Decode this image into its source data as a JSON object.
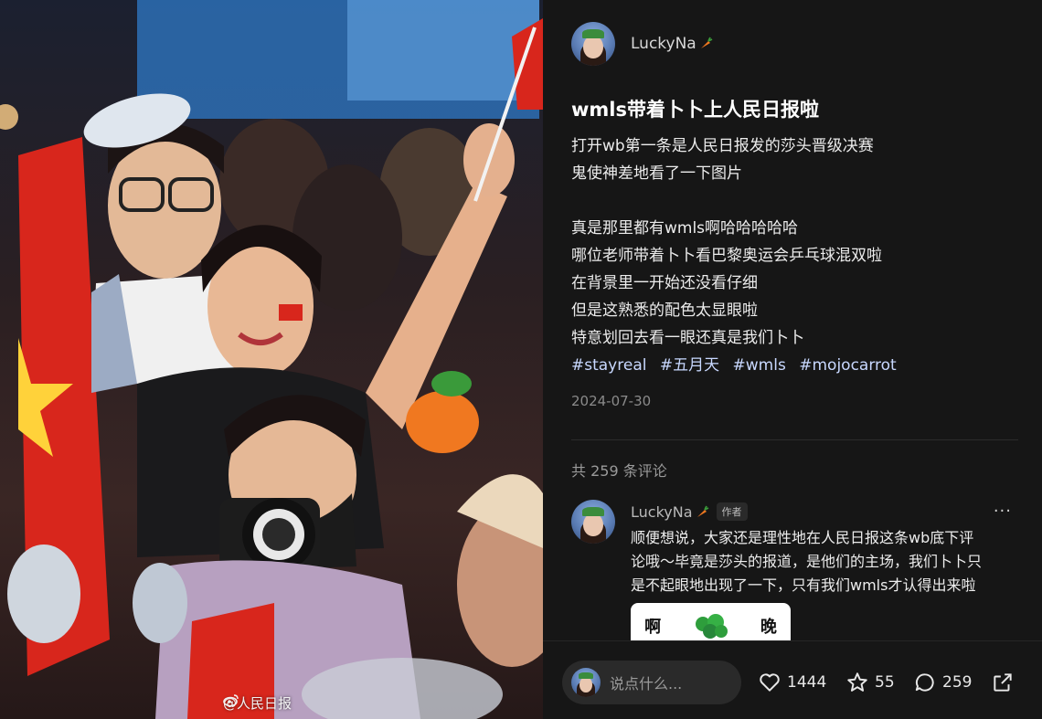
{
  "photo": {
    "watermark": "@人民日报"
  },
  "post": {
    "author": "LuckyNa",
    "title": "wmls带着卜卜上人民日报啦",
    "body_lines": [
      "打开wb第一条是人民日报发的莎头晋级决赛",
      "鬼使神差地看了一下图片",
      "",
      "真是那里都有wmls啊哈哈哈哈哈",
      "哪位老师带着卜卜看巴黎奥运会乒乓球混双啦",
      "在背景里一开始还没看仔细",
      "但是这熟悉的配色太显眼啦",
      "特意划回去看一眼还真是我们卜卜"
    ],
    "tags": [
      "#stayreal",
      "#五月天",
      "#wmls",
      "#mojocarrot"
    ],
    "date": "2024-07-30"
  },
  "comments": {
    "count_label": "共 259 条评论",
    "items": [
      {
        "name": "LuckyNa",
        "badge": "作者",
        "more": "···",
        "lines": [
          "顺便想说，大家还是理性地在人民日报这条wb底下评",
          "论哦～毕竟是莎头的报道，是他们的主场，我们卜卜只",
          "是不起眼地出现了一下，只有我们wmls才认得出来啦"
        ],
        "sticker_left": "啊",
        "sticker_right": "晚"
      }
    ]
  },
  "bottom": {
    "placeholder": "说点什么...",
    "likes": "1444",
    "stars": "55",
    "comments": "259"
  },
  "colors": {
    "panel_bg": "#161616",
    "tag": "#c8d8ff",
    "muted": "#8a8a8a"
  }
}
